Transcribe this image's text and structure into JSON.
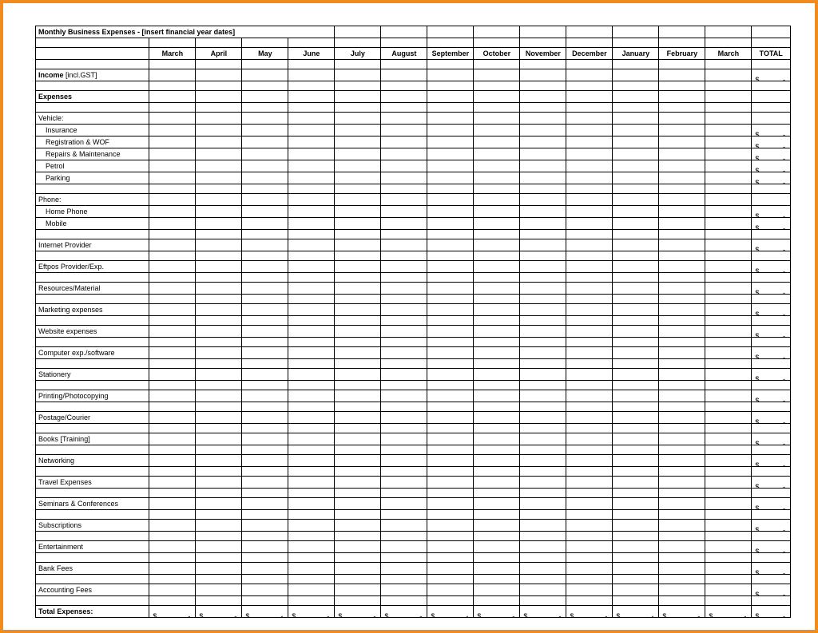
{
  "title": "Monthly Business Expenses - [insert financial year dates]",
  "months": [
    "March",
    "April",
    "May",
    "June",
    "July",
    "August",
    "September",
    "October",
    "November",
    "December",
    "January",
    "February",
    "March"
  ],
  "totalHeader": "TOTAL",
  "currencySymbol": "$",
  "dash": "-",
  "rows": [
    {
      "type": "blank"
    },
    {
      "type": "item",
      "label": "Income [incl.GST]",
      "bold": true,
      "boldPart": "Income",
      "restPart": " [incl.GST]",
      "hasTotal": true
    },
    {
      "type": "blank"
    },
    {
      "type": "item",
      "label": "Expenses",
      "bold": true,
      "hasTotal": false
    },
    {
      "type": "blank"
    },
    {
      "type": "item",
      "label": "Vehicle:",
      "hasTotal": false
    },
    {
      "type": "item",
      "label": "Insurance",
      "indent": true,
      "hasTotal": true
    },
    {
      "type": "item",
      "label": "Registration & WOF",
      "indent": true,
      "hasTotal": true
    },
    {
      "type": "item",
      "label": "Repairs & Maintenance",
      "indent": true,
      "hasTotal": true
    },
    {
      "type": "item",
      "label": "Petrol",
      "indent": true,
      "hasTotal": true
    },
    {
      "type": "item",
      "label": "Parking",
      "indent": true,
      "hasTotal": true
    },
    {
      "type": "blank"
    },
    {
      "type": "item",
      "label": "Phone:",
      "hasTotal": false
    },
    {
      "type": "item",
      "label": "Home Phone",
      "indent": true,
      "hasTotal": true
    },
    {
      "type": "item",
      "label": "Mobile",
      "indent": true,
      "hasTotal": true
    },
    {
      "type": "blank"
    },
    {
      "type": "item",
      "label": "Internet Provider",
      "hasTotal": true
    },
    {
      "type": "blank"
    },
    {
      "type": "item",
      "label": "Eftpos Provider/Exp.",
      "hasTotal": true
    },
    {
      "type": "blank"
    },
    {
      "type": "item",
      "label": "Resources/Material",
      "hasTotal": true
    },
    {
      "type": "blank"
    },
    {
      "type": "item",
      "label": "Marketing expenses",
      "hasTotal": true
    },
    {
      "type": "blank"
    },
    {
      "type": "item",
      "label": "Website expenses",
      "hasTotal": true
    },
    {
      "type": "blank"
    },
    {
      "type": "item",
      "label": "Computer exp./software",
      "hasTotal": true
    },
    {
      "type": "blank"
    },
    {
      "type": "item",
      "label": "Stationery",
      "hasTotal": true
    },
    {
      "type": "blank"
    },
    {
      "type": "item",
      "label": "Printing/Photocopying",
      "hasTotal": true
    },
    {
      "type": "blank"
    },
    {
      "type": "item",
      "label": "Postage/Courier",
      "hasTotal": true
    },
    {
      "type": "blank"
    },
    {
      "type": "item",
      "label": "Books [Training]",
      "hasTotal": true
    },
    {
      "type": "blank"
    },
    {
      "type": "item",
      "label": "Networking",
      "hasTotal": true
    },
    {
      "type": "blank"
    },
    {
      "type": "item",
      "label": "Travel Expenses",
      "hasTotal": true
    },
    {
      "type": "blank"
    },
    {
      "type": "item",
      "label": "Seminars & Conferences",
      "hasTotal": true
    },
    {
      "type": "blank"
    },
    {
      "type": "item",
      "label": "Subscriptions",
      "hasTotal": true
    },
    {
      "type": "blank"
    },
    {
      "type": "item",
      "label": "Entertainment",
      "hasTotal": true
    },
    {
      "type": "blank"
    },
    {
      "type": "item",
      "label": "Bank Fees",
      "hasTotal": true
    },
    {
      "type": "blank"
    },
    {
      "type": "item",
      "label": "Accounting Fees",
      "hasTotal": true
    },
    {
      "type": "blank"
    },
    {
      "type": "totals",
      "label": "Total Expenses:",
      "bold": true
    }
  ]
}
